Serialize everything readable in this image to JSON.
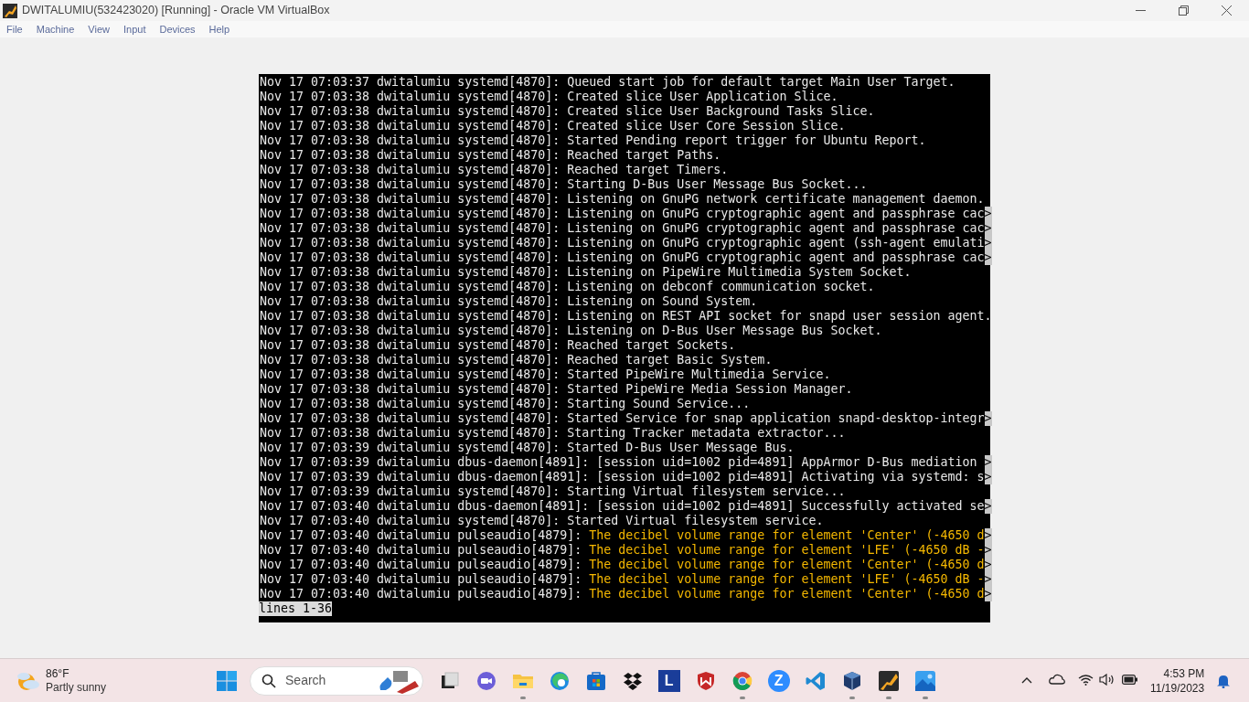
{
  "window": {
    "title": "DWITALUMIU(532423020) [Running] - Oracle VM VirtualBox"
  },
  "menu": [
    "File",
    "Machine",
    "View",
    "Input",
    "Devices",
    "Help"
  ],
  "terminal": {
    "lines": [
      {
        "prefix": "Nov 17 07:03:37 dwitalumiu systemd[4870]: ",
        "message": "Queued start job for default target Main User Target.",
        "kind": "info"
      },
      {
        "prefix": "Nov 17 07:03:38 dwitalumiu systemd[4870]: ",
        "message": "Created slice User Application Slice.",
        "kind": "info"
      },
      {
        "prefix": "Nov 17 07:03:38 dwitalumiu systemd[4870]: ",
        "message": "Created slice User Background Tasks Slice.",
        "kind": "info"
      },
      {
        "prefix": "Nov 17 07:03:38 dwitalumiu systemd[4870]: ",
        "message": "Created slice User Core Session Slice.",
        "kind": "info"
      },
      {
        "prefix": "Nov 17 07:03:38 dwitalumiu systemd[4870]: ",
        "message": "Started Pending report trigger for Ubuntu Report.",
        "kind": "info"
      },
      {
        "prefix": "Nov 17 07:03:38 dwitalumiu systemd[4870]: ",
        "message": "Reached target Paths.",
        "kind": "info"
      },
      {
        "prefix": "Nov 17 07:03:38 dwitalumiu systemd[4870]: ",
        "message": "Reached target Timers.",
        "kind": "info"
      },
      {
        "prefix": "Nov 17 07:03:38 dwitalumiu systemd[4870]: ",
        "message": "Starting D-Bus User Message Bus Socket...",
        "kind": "info"
      },
      {
        "prefix": "Nov 17 07:03:38 dwitalumiu systemd[4870]: ",
        "message": "Listening on GnuPG network certificate management daemon.",
        "kind": "info"
      },
      {
        "prefix": "Nov 17 07:03:38 dwitalumiu systemd[4870]: ",
        "message": "Listening on GnuPG cryptographic agent and passphrase cac",
        "kind": "info",
        "overflow": ">"
      },
      {
        "prefix": "Nov 17 07:03:38 dwitalumiu systemd[4870]: ",
        "message": "Listening on GnuPG cryptographic agent and passphrase cac",
        "kind": "info",
        "overflow": ">"
      },
      {
        "prefix": "Nov 17 07:03:38 dwitalumiu systemd[4870]: ",
        "message": "Listening on GnuPG cryptographic agent (ssh-agent emulati",
        "kind": "info",
        "overflow": ">"
      },
      {
        "prefix": "Nov 17 07:03:38 dwitalumiu systemd[4870]: ",
        "message": "Listening on GnuPG cryptographic agent and passphrase cac",
        "kind": "info",
        "overflow": ">"
      },
      {
        "prefix": "Nov 17 07:03:38 dwitalumiu systemd[4870]: ",
        "message": "Listening on PipeWire Multimedia System Socket.",
        "kind": "info"
      },
      {
        "prefix": "Nov 17 07:03:38 dwitalumiu systemd[4870]: ",
        "message": "Listening on debconf communication socket.",
        "kind": "info"
      },
      {
        "prefix": "Nov 17 07:03:38 dwitalumiu systemd[4870]: ",
        "message": "Listening on Sound System.",
        "kind": "info"
      },
      {
        "prefix": "Nov 17 07:03:38 dwitalumiu systemd[4870]: ",
        "message": "Listening on REST API socket for snapd user session agent.",
        "kind": "info"
      },
      {
        "prefix": "Nov 17 07:03:38 dwitalumiu systemd[4870]: ",
        "message": "Listening on D-Bus User Message Bus Socket.",
        "kind": "info"
      },
      {
        "prefix": "Nov 17 07:03:38 dwitalumiu systemd[4870]: ",
        "message": "Reached target Sockets.",
        "kind": "info"
      },
      {
        "prefix": "Nov 17 07:03:38 dwitalumiu systemd[4870]: ",
        "message": "Reached target Basic System.",
        "kind": "info"
      },
      {
        "prefix": "Nov 17 07:03:38 dwitalumiu systemd[4870]: ",
        "message": "Started PipeWire Multimedia Service.",
        "kind": "info"
      },
      {
        "prefix": "Nov 17 07:03:38 dwitalumiu systemd[4870]: ",
        "message": "Started PipeWire Media Session Manager.",
        "kind": "info"
      },
      {
        "prefix": "Nov 17 07:03:38 dwitalumiu systemd[4870]: ",
        "message": "Starting Sound Service...",
        "kind": "info"
      },
      {
        "prefix": "Nov 17 07:03:38 dwitalumiu systemd[4870]: ",
        "message": "Started Service for snap application snapd-desktop-integr",
        "kind": "info",
        "overflow": ">"
      },
      {
        "prefix": "Nov 17 07:03:38 dwitalumiu systemd[4870]: ",
        "message": "Starting Tracker metadata extractor...",
        "kind": "info"
      },
      {
        "prefix": "Nov 17 07:03:39 dwitalumiu systemd[4870]: ",
        "message": "Started D-Bus User Message Bus.",
        "kind": "info"
      },
      {
        "prefix": "Nov 17 07:03:39 dwitalumiu dbus-daemon[4891]: ",
        "message": "[session uid=1002 pid=4891] AppArmor D-Bus mediation ",
        "kind": "info",
        "overflow": ">"
      },
      {
        "prefix": "Nov 17 07:03:39 dwitalumiu dbus-daemon[4891]: ",
        "message": "[session uid=1002 pid=4891] Activating via systemd: s",
        "kind": "info",
        "overflow": ">"
      },
      {
        "prefix": "Nov 17 07:03:39 dwitalumiu systemd[4870]: ",
        "message": "Starting Virtual filesystem service...",
        "kind": "info"
      },
      {
        "prefix": "Nov 17 07:03:40 dwitalumiu dbus-daemon[4891]: ",
        "message": "[session uid=1002 pid=4891] Successfully activated se",
        "kind": "info",
        "overflow": ">"
      },
      {
        "prefix": "Nov 17 07:03:40 dwitalumiu systemd[4870]: ",
        "message": "Started Virtual filesystem service.",
        "kind": "info"
      },
      {
        "prefix": "Nov 17 07:03:40 dwitalumiu pulseaudio[4879]: ",
        "message": "The decibel volume range for element 'Center' (-4650 d",
        "kind": "warning",
        "overflow": ">"
      },
      {
        "prefix": "Nov 17 07:03:40 dwitalumiu pulseaudio[4879]: ",
        "message": "The decibel volume range for element 'LFE' (-4650 dB -",
        "kind": "warning",
        "overflow": ">"
      },
      {
        "prefix": "Nov 17 07:03:40 dwitalumiu pulseaudio[4879]: ",
        "message": "The decibel volume range for element 'Center' (-4650 d",
        "kind": "warning",
        "overflow": ">"
      },
      {
        "prefix": "Nov 17 07:03:40 dwitalumiu pulseaudio[4879]: ",
        "message": "The decibel volume range for element 'LFE' (-4650 dB -",
        "kind": "warning",
        "overflow": ">"
      },
      {
        "prefix": "Nov 17 07:03:40 dwitalumiu pulseaudio[4879]: ",
        "message": "The decibel volume range for element 'Center' (-4650 d",
        "kind": "warning",
        "overflow": ">"
      }
    ],
    "pager_status": "lines 1-36"
  },
  "taskbar": {
    "weather": {
      "temperature": "86°F",
      "condition": "Partly sunny"
    },
    "search": {
      "placeholder": "Search"
    },
    "apps": [
      {
        "kind": "task-view",
        "running": false
      },
      {
        "kind": "chat",
        "running": false
      },
      {
        "kind": "folder",
        "running": true
      },
      {
        "kind": "edge",
        "running": false
      },
      {
        "kind": "store",
        "running": false
      },
      {
        "kind": "dropbox",
        "running": false
      },
      {
        "kind": "letter",
        "label": "L",
        "running": false
      },
      {
        "kind": "shield",
        "running": false
      },
      {
        "kind": "chrome",
        "running": true
      },
      {
        "kind": "letter-circle",
        "label": "Z",
        "running": false
      },
      {
        "kind": "code",
        "running": false
      },
      {
        "kind": "cube",
        "running": true
      },
      {
        "kind": "vbox-app",
        "running": true
      },
      {
        "kind": "photos",
        "running": true
      }
    ],
    "clock": {
      "time": "4:53 PM",
      "date": "11/19/2023"
    }
  }
}
